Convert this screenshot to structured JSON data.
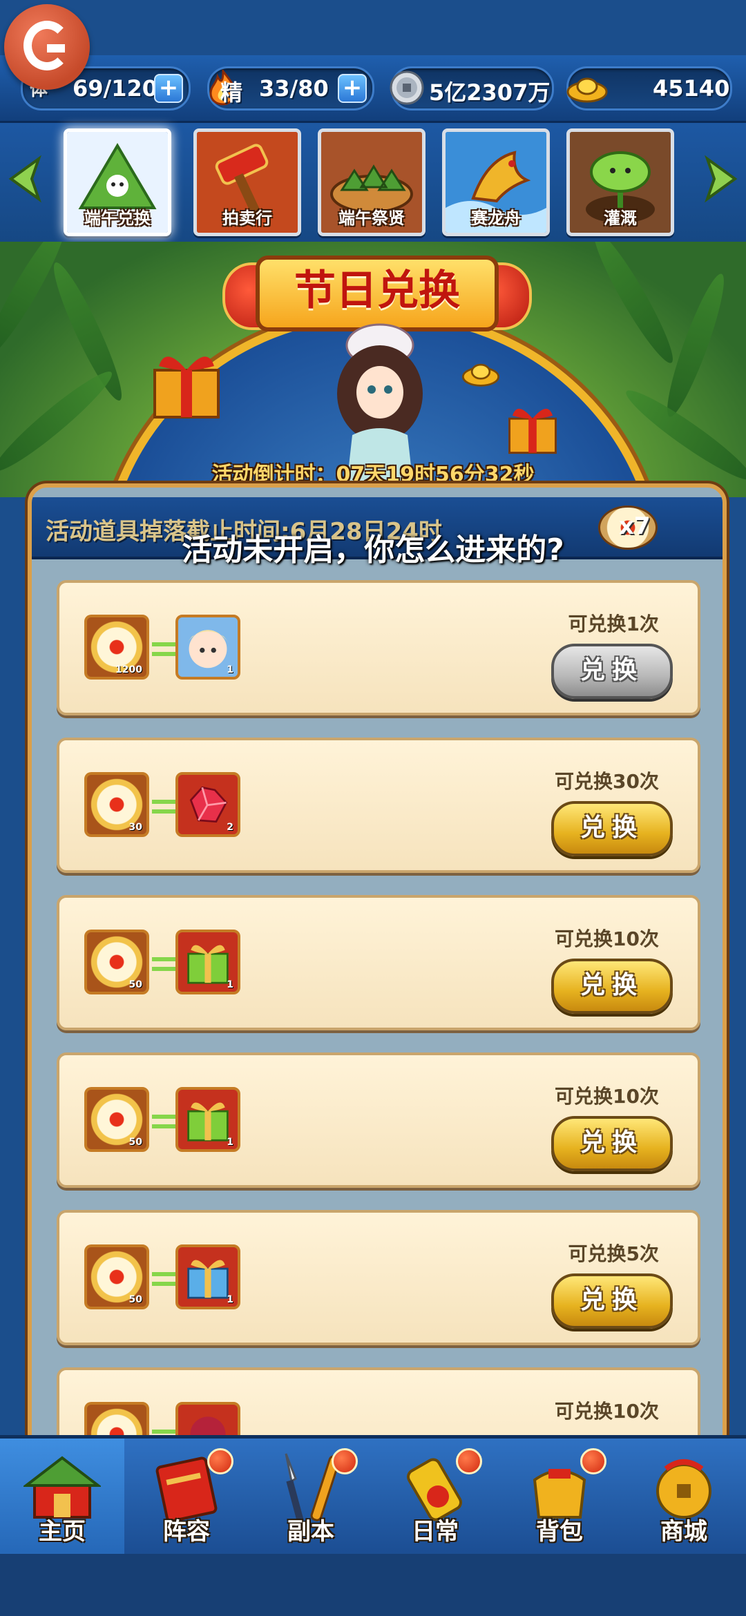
{
  "status_bar": {
    "stamina_label": "体",
    "stamina_value": "69/120",
    "energy_label": "精",
    "energy_value": "33/80",
    "silver_value": "5亿2307万",
    "gold_value": "45140"
  },
  "tabs": [
    {
      "label": "端午兑换",
      "active": true
    },
    {
      "label": "拍卖行",
      "active": false
    },
    {
      "label": "端午祭贤",
      "active": false
    },
    {
      "label": "赛龙舟",
      "active": false
    },
    {
      "label": "灌溉",
      "active": false
    }
  ],
  "banner": {
    "title": "节日兑换",
    "countdown": "活动倒计时：07天19时56分32秒"
  },
  "panel": {
    "notice": "活动道具掉落截止时间:6月28日24时",
    "egg_count": "x7"
  },
  "toast": "活动未开启，你怎么进来的?",
  "exchange_items": [
    {
      "cost_qty": "1200",
      "reward_qty": "1",
      "reward_icon": "hero-portrait-icon",
      "count_text": "可兑换1次",
      "button": "兑换",
      "enabled": false
    },
    {
      "cost_qty": "30",
      "reward_qty": "2",
      "reward_icon": "red-gem-icon",
      "count_text": "可兑换30次",
      "button": "兑换",
      "enabled": true
    },
    {
      "cost_qty": "50",
      "reward_qty": "1",
      "reward_icon": "green-gift-icon",
      "count_text": "可兑换10次",
      "button": "兑换",
      "enabled": true
    },
    {
      "cost_qty": "50",
      "reward_qty": "1",
      "reward_icon": "green-gift-icon",
      "count_text": "可兑换10次",
      "button": "兑换",
      "enabled": true
    },
    {
      "cost_qty": "50",
      "reward_qty": "1",
      "reward_icon": "blue-gift-icon",
      "count_text": "可兑换5次",
      "button": "兑换",
      "enabled": true
    },
    {
      "cost_qty": "",
      "reward_qty": "",
      "reward_icon": "red-orb-icon",
      "count_text": "可兑换10次",
      "button": "",
      "enabled": true
    }
  ],
  "bottom_nav": [
    {
      "label": "主页",
      "icon": "palace-icon",
      "active": true,
      "badge": false
    },
    {
      "label": "阵容",
      "icon": "scroll-icon",
      "active": false,
      "badge": true
    },
    {
      "label": "副本",
      "icon": "sword-icon",
      "active": false,
      "badge": true
    },
    {
      "label": "日常",
      "icon": "firecracker-icon",
      "active": false,
      "badge": true
    },
    {
      "label": "背包",
      "icon": "bag-icon",
      "active": false,
      "badge": true
    },
    {
      "label": "商城",
      "icon": "coin-bag-icon",
      "active": false,
      "badge": false
    }
  ],
  "colors": {
    "accent_gold": "#f0b52a",
    "panel_blue": "#1a4e94",
    "disabled_grey": "#b8b8b8"
  }
}
